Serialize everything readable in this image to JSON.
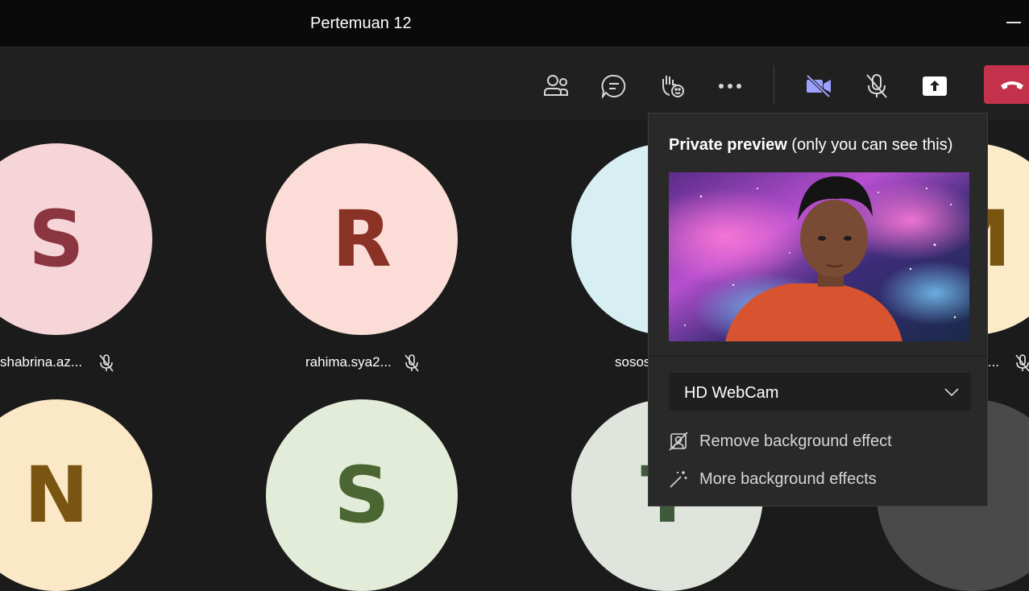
{
  "window": {
    "title": "Pertemuan 12"
  },
  "toolbar": {
    "participants": "people-icon",
    "chat": "chat-icon",
    "react": "raise-hand-icon",
    "more": "more-icon",
    "camera": "camera-off-icon",
    "mic": "mic-off-icon",
    "share": "share-icon",
    "leave": "phone-icon",
    "accent": "#9ea2ff",
    "leave_color": "#c4314b"
  },
  "participants": [
    {
      "initial": "S",
      "name": "shabrina.az...",
      "bg": "#f6d5d8",
      "fg": "#8b3540"
    },
    {
      "initial": "R",
      "name": "rahima.sya2...",
      "bg": "#fbdcd6",
      "fg": "#8a3226"
    },
    {
      "initial": "",
      "name": "sosos",
      "bg": "#d7eef2",
      "fg": "#2f6570"
    },
    {
      "initial": "M",
      "name": "j...",
      "bg": "#fbebc9",
      "fg": "#7a5512"
    },
    {
      "initial": "N",
      "name": "",
      "bg": "#fbe8c6",
      "fg": "#7a5512"
    },
    {
      "initial": "S",
      "name": "",
      "bg": "#e3ecd9",
      "fg": "#4a6632"
    },
    {
      "initial": "T",
      "name": "",
      "bg": "#dfe4dc",
      "fg": "#3f5a3a"
    },
    {
      "initial": "",
      "name": "",
      "bg": "#4a4a4a",
      "fg": "#ffffff"
    }
  ],
  "preview": {
    "title_bold": "Private preview",
    "title_rest": " (only you can see this)",
    "camera_device": "HD WebCam",
    "options": [
      {
        "label": "Remove background effect",
        "icon": "remove-background-icon"
      },
      {
        "label": "More background effects",
        "icon": "magic-wand-icon"
      }
    ]
  }
}
